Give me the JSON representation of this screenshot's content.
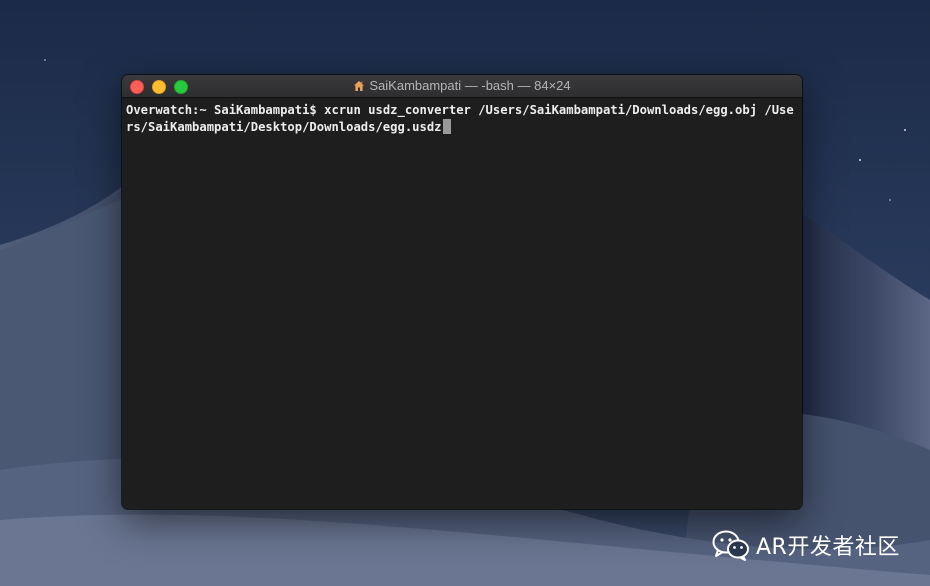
{
  "window": {
    "title": "SaiKambampati — -bash — 84×24",
    "title_icon": "home-icon"
  },
  "terminal": {
    "prompt": "Overwatch:~ SaiKambampati$ ",
    "command": "xcrun usdz_converter /Users/SaiKambampati/Downloads/egg.obj /Users/SaiKambampati/Desktop/Downloads/egg.usdz"
  },
  "watermark": {
    "icon": "wechat-icon",
    "text": "AR开发者社区"
  },
  "colors": {
    "terminal_bg": "#1e1e1e",
    "terminal_text": "#ededed",
    "close": "#fe5f57",
    "minimize": "#febc2e",
    "zoom": "#28c840"
  }
}
